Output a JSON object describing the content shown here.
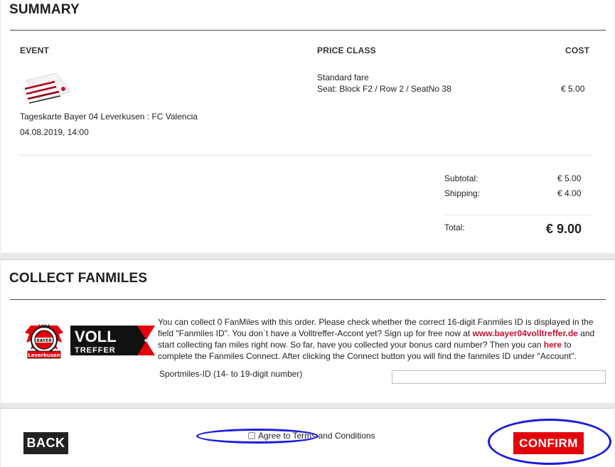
{
  "summary": {
    "title": "SUMMARY",
    "columns": {
      "event": "EVENT",
      "price_class": "PRICE CLASS",
      "cost": "COST"
    },
    "item": {
      "event_name": "Tageskarte Bayer 04 Leverkusen : FC Valencia",
      "event_date": "04.08.2019, 14:00",
      "fare": "Standard fare",
      "seat": "Seat: Block F2 / Row 2 / SeatNo 38",
      "cost": "€ 5.00"
    },
    "totals": {
      "subtotal_label": "Subtotal:",
      "subtotal_value": "€ 5.00",
      "shipping_label": "Shipping:",
      "shipping_value": "€ 4.00",
      "total_label": "Total:",
      "total_value": "€ 9.00"
    }
  },
  "fanmiles": {
    "title": "COLLECT FANMILES",
    "text_part1": "You can collect 0 FanMiles with this order. Please check whether the correct 16-digit Fanmiles ID is displayed in the field \"Fanmiles ID\". You don`t have a Volltreffer-Accont yet? Sign up for free now at ",
    "link_site": "www.bayer04volltreffer.de",
    "text_part2": " and start collecting fan miles right now. So far, have you collected your bonus card number? Then you can ",
    "link_here": "here",
    "text_part3": " to complete the Fanmiles Connect. After clicking the Connect button you will find the fanmiles ID under \"Account\".",
    "sportmiles_label": "Sportmiles-ID (14- to 19-digit number)",
    "sportmiles_value": "",
    "logo": {
      "year": "1904",
      "name": "BAYER",
      "city": "Leverkusen",
      "voll": "VOLL",
      "treffer": "TREFFER"
    }
  },
  "footer": {
    "back_label": "BACK",
    "terms_label": "Agree to Terms and Conditions",
    "confirm_label": "CONFIRM"
  },
  "colors": {
    "accent_red": "#e3000b",
    "dark_button": "#222222",
    "annotation_blue": "#1a1ae0"
  }
}
